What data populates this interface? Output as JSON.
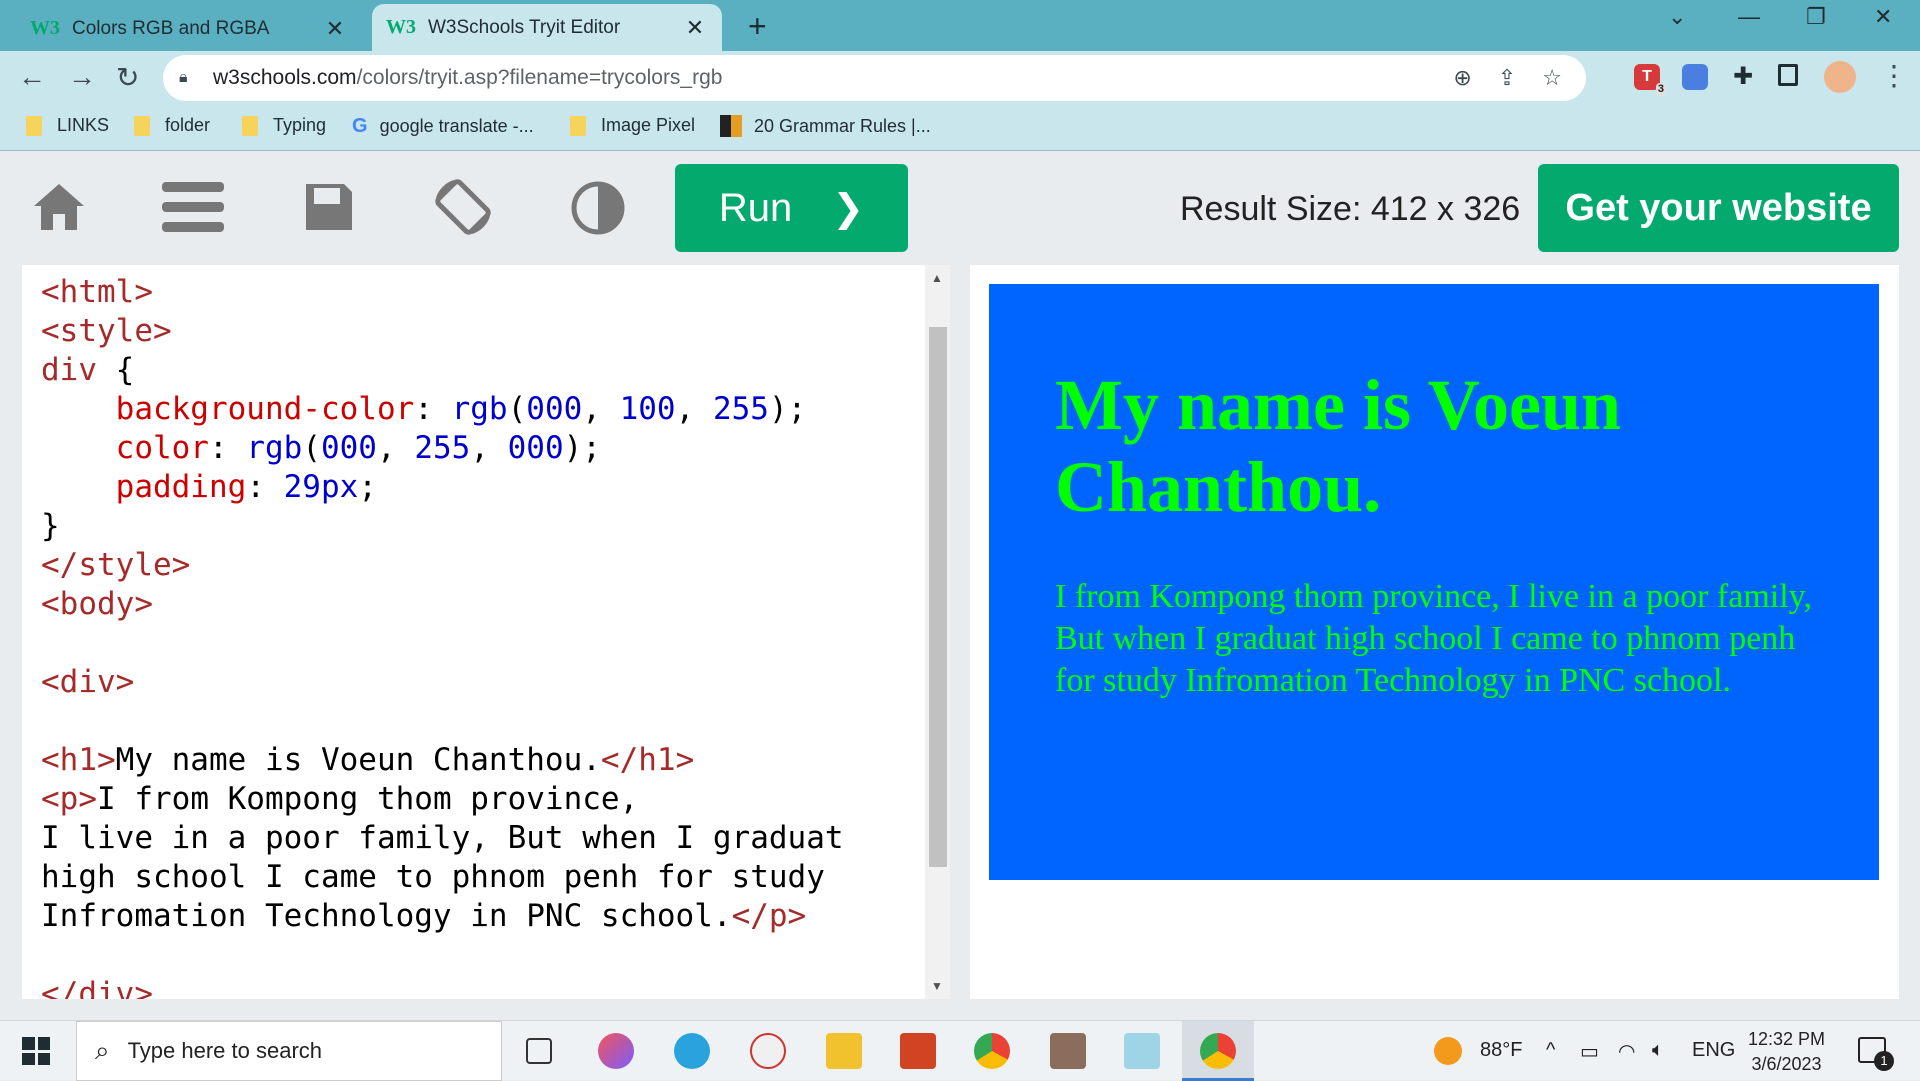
{
  "browser": {
    "tabs": [
      {
        "title": "Colors RGB and RGBA",
        "logo": "W3",
        "active": false
      },
      {
        "title": "W3Schools Tryit Editor",
        "logo": "W3",
        "active": true
      }
    ],
    "url_host": "w3schools.com",
    "url_path": "/colors/tryit.asp?filename=trycolors_rgb",
    "bookmarks": [
      {
        "label": "LINKS",
        "icon": "folder-icon"
      },
      {
        "label": "folder",
        "icon": "folder-icon"
      },
      {
        "label": "Typing",
        "icon": "folder-icon"
      },
      {
        "label": "google translate -...",
        "icon": "google-icon"
      },
      {
        "label": "Image Pixel",
        "icon": "folder-icon"
      },
      {
        "label": "20 Grammar Rules |...",
        "icon": "site-icon"
      }
    ],
    "extension_badge": "3"
  },
  "tryit": {
    "run_label": "Run",
    "result_size": "Result Size: 412 x 326",
    "get_website_label": "Get your website",
    "code_lines": [
      "<html>",
      "<style>",
      "div {",
      "    background-color: rgb(000, 100, 255);",
      "    color: rgb(000, 255, 000);",
      "    padding: 29px;",
      "}",
      "</style>",
      "<body>",
      "",
      "<div>",
      "",
      "<h1>My name is Voeun Chanthou.</h1>",
      "<p>I from Kompong thom province,",
      "I live in a poor family, But when I graduat",
      "high school I came to phnom penh for study",
      "Infromation Technology in PNC school.</p>",
      "",
      "</div>"
    ],
    "result": {
      "heading": "My name is Voeun Chanthou.",
      "paragraph": "I from Kompong thom province, I live in a poor family, But when I graduat high school I came to phnom penh for study Infromation Technology in PNC school.",
      "background_color": "#0064ff",
      "text_color": "#00ff00"
    }
  },
  "taskbar": {
    "search_placeholder": "Type here to search",
    "weather": "88°F",
    "language": "ENG",
    "time": "12:32 PM",
    "date": "3/6/2023",
    "notification_count": "1"
  },
  "colors": {
    "accent_green": "#04aa6d",
    "tab_bar": "#5aafc0",
    "toolbar": "#c8e6ec"
  }
}
